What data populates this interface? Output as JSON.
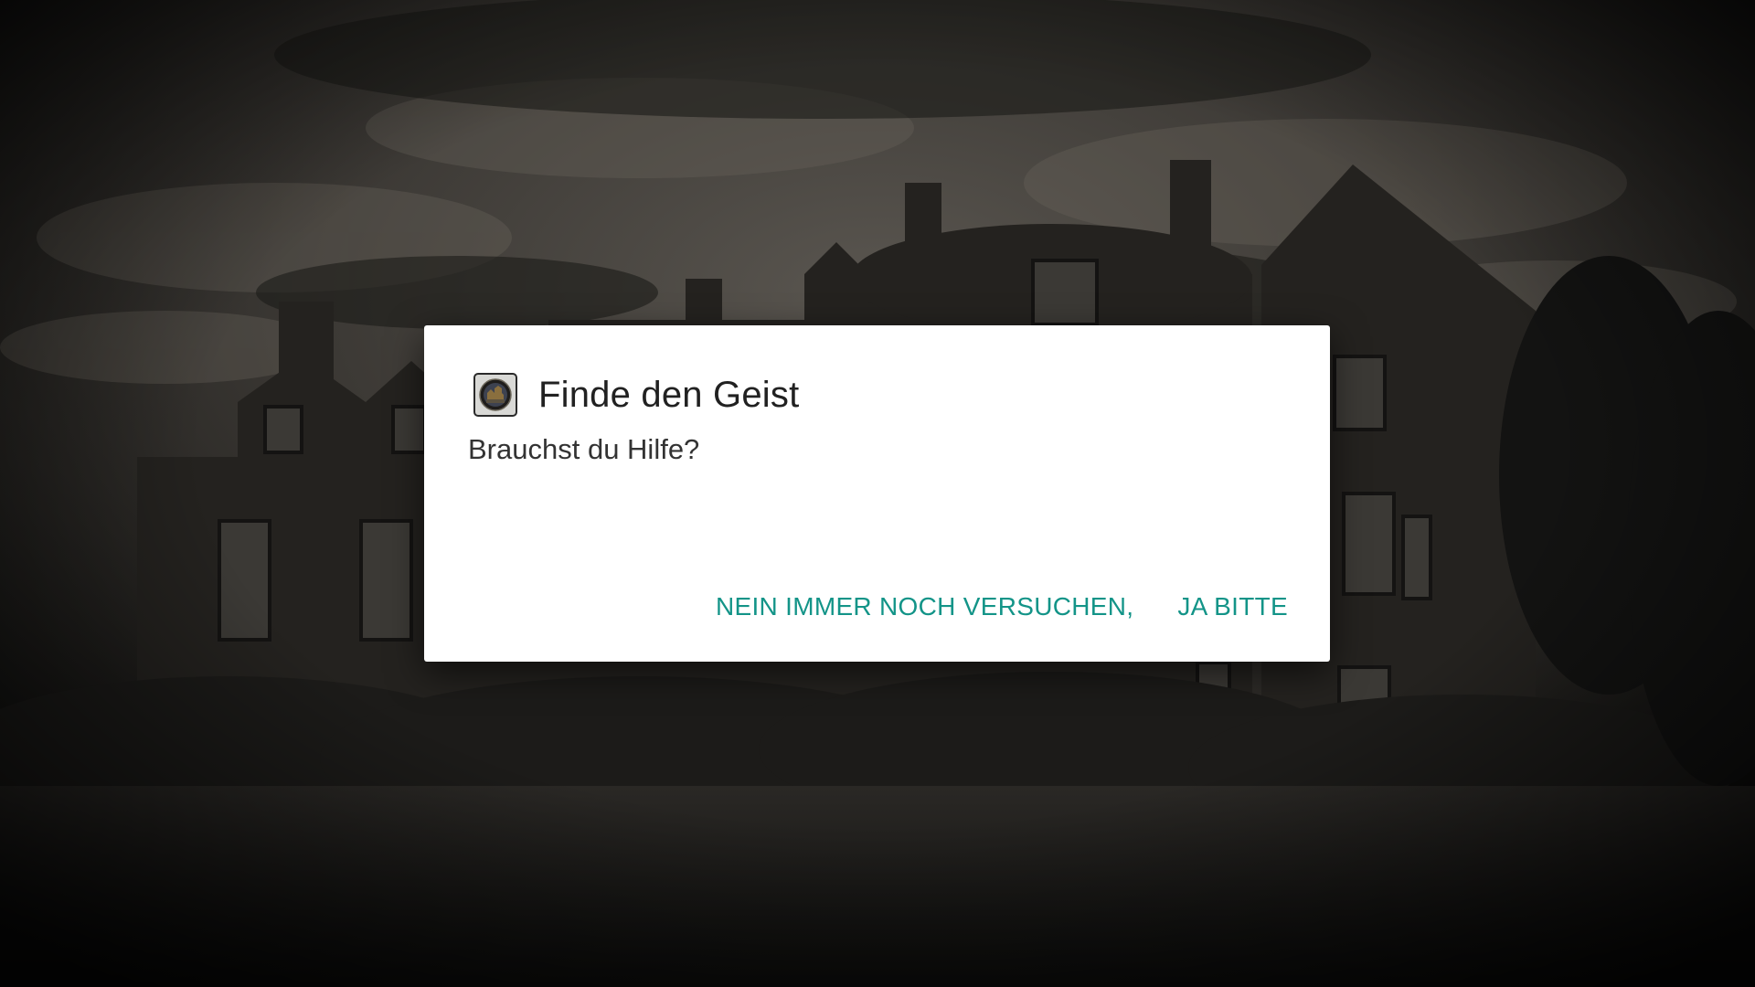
{
  "dialog": {
    "title": "Finde den Geist",
    "message": "Brauchst du Hilfe?",
    "icon": "app-icon-ghost-house",
    "negative_label": "NEIN IMMER NOCH VERSUCHEN,",
    "positive_label": "JA BITTE"
  },
  "colors": {
    "accent": "#139488",
    "dialog_background": "#ffffff",
    "title_text": "#212121",
    "message_text": "#333333"
  }
}
